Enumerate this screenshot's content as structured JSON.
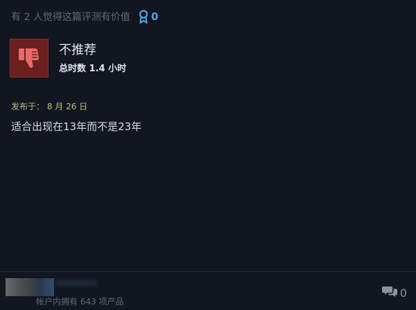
{
  "helpful": {
    "text": "有 2 人觉得这篇评测有价值",
    "award_icon": "award-ribbon-icon",
    "award_count": "0"
  },
  "verdict": {
    "icon": "thumbs-down-icon",
    "title": "不推荐",
    "hours": "总时数 1.4 小时"
  },
  "posted": "发布于： 8 月 26 日",
  "review_text": "适合出现在13年而不是23年",
  "author": {
    "products_owned": "帐户内拥有 643 项产品"
  },
  "comments": {
    "icon": "comment-bubbles-icon",
    "count": "0"
  },
  "colors": {
    "background": "#111620",
    "thumb_box": "#6b1f1f",
    "award_accent": "#5ba3d9",
    "posted_date": "#c0ba88"
  }
}
